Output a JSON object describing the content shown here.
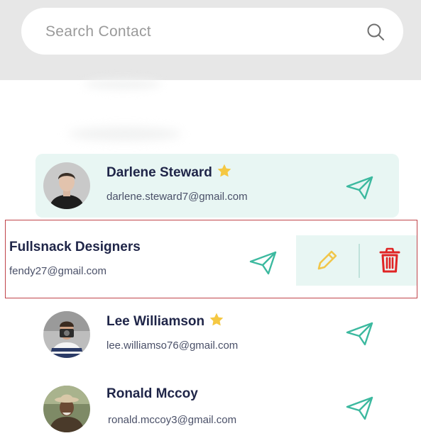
{
  "search": {
    "placeholder": "Search Contact"
  },
  "contacts": [
    {
      "name": "Darlene Steward",
      "email": "darlene.steward7@gmail.com",
      "starred": true
    },
    {
      "name": "Fullsnack Designers",
      "email": "fendy27@gmail.com",
      "starred": false
    },
    {
      "name": "Lee Williamson",
      "email": "lee.williamso76@gmail.com",
      "starred": true
    },
    {
      "name": "Ronald Mccoy",
      "email": "ronald.mccoy3@gmail.com",
      "starred": false
    }
  ],
  "colors": {
    "accent": "#3cb99f",
    "highlight_bg": "#e8f6f3",
    "star": "#f5c842",
    "edit": "#f1c64a",
    "delete": "#e02424",
    "name": "#1f2548"
  },
  "icons": {
    "search": "search-icon",
    "send": "send-icon",
    "star": "star-icon",
    "edit": "pencil-icon",
    "delete": "trash-icon"
  }
}
